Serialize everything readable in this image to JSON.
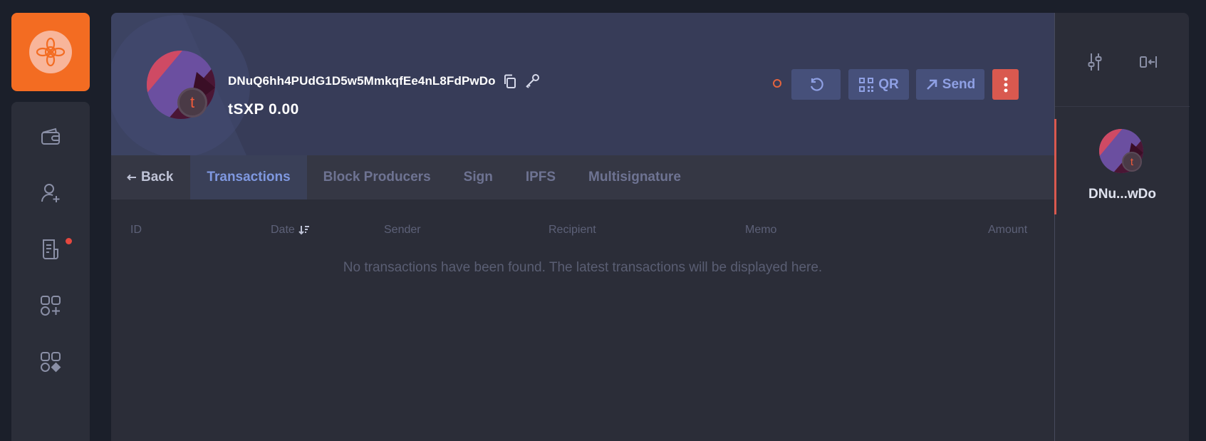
{
  "colors": {
    "accent_orange": "#f36c22",
    "danger_red": "#d9594f",
    "primary_blue": "#7f98e0",
    "background": "#1b1f2a",
    "panel": "#2b2d38"
  },
  "app_sidebar": {
    "logo_icon": "app-logo-icon",
    "items": [
      {
        "icon": "wallet-icon"
      },
      {
        "icon": "add-contact-icon"
      },
      {
        "icon": "document-icon",
        "has_notification": true
      },
      {
        "icon": "add-app-icon"
      },
      {
        "icon": "apps-icon"
      }
    ]
  },
  "wallet": {
    "address": "DNuQ6hh4PUdG1D5w5MmkqfEe4nL8FdPwDo",
    "balance": "tSXP 0.00",
    "avatar_letter": "t"
  },
  "actions": {
    "refresh_icon": "refresh-icon",
    "qr_label": "QR",
    "send_label": "Send",
    "more_icon": "more-vertical-icon"
  },
  "tabs": {
    "back": "Back",
    "items": [
      "Transactions",
      "Block Producers",
      "Sign",
      "IPFS",
      "Multisignature"
    ],
    "active": "Transactions"
  },
  "table": {
    "columns": {
      "id": "ID",
      "date": "Date",
      "sender": "Sender",
      "recipient": "Recipient",
      "memo": "Memo",
      "amount": "Amount"
    },
    "sort_column": "Date",
    "empty_message": "No transactions have been found. The latest transactions will be displayed here."
  },
  "right_panel": {
    "settings_icon": "sliders-icon",
    "collapse_icon": "collapse-panel-icon",
    "wallets": [
      {
        "name": "DNu...wDo",
        "avatar_letter": "t",
        "selected": true
      }
    ]
  }
}
